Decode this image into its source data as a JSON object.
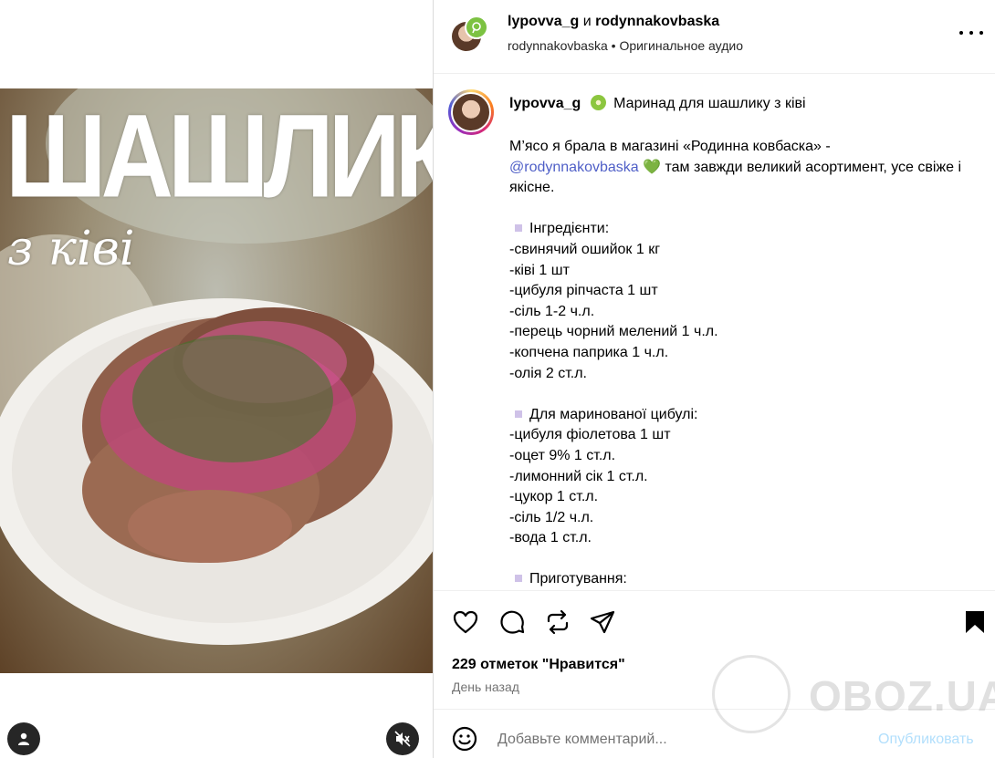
{
  "media": {
    "overlay_title": "ШАШЛИК",
    "overlay_subtitle": "з ківі",
    "user_tag_icon": "user-icon",
    "mute_icon": "speaker-muted-icon"
  },
  "header": {
    "user1": "lypovva_g",
    "conjunction": "и",
    "user2": "rodynnakovbaska",
    "sub_user": "rodynnakovbaska",
    "separator": "•",
    "audio": "Оригинальное аудио",
    "more_icon": "more-dots-icon"
  },
  "caption": {
    "username": "lypovva_g",
    "title": "Маринад для шашлику з ківі",
    "intro": "М’ясо я брала в магазині «Родинна ковбаска» -",
    "mention": "@rodynnakovbaska",
    "intro_rest": "там завжди великий асортимент, усе свіже і якісне.",
    "ingredients_heading": "Інгредієнти:",
    "ingredients": [
      "-свинячий ошийок 1 кг",
      "-ківі 1 шт",
      "-цибуля ріпчаста 1 шт",
      "-сіль 1-2 ч.л.",
      "-перець чорний мелений 1 ч.л.",
      "-копчена паприка 1 ч.л.",
      "-олія 2 ст.л."
    ],
    "onion_heading": "Для маринованої цибулі:",
    "onion_items": [
      "-цибуля фіолетова 1 шт",
      "-оцет 9% 1 ст.л.",
      "-лимонний сік 1 ст.л.",
      "-цукор 1 ст.л.",
      "-сіль 1/2 ч.л.",
      "-вода 1 ст.л."
    ],
    "prep_heading": "Приготування:"
  },
  "actions": {
    "like_icon": "heart-icon",
    "comment_icon": "comment-bubble-icon",
    "repost_icon": "repost-icon",
    "share_icon": "paper-plane-icon",
    "save_icon": "bookmark-icon",
    "likes_text": "229 отметок \"Нравится\"",
    "time_text": "День назад"
  },
  "comment": {
    "emoji_icon": "smiley-icon",
    "placeholder": "Добавьте комментарий...",
    "post_label": "Опубликовать"
  },
  "watermark": {
    "text": "OBOZ.UA"
  },
  "colors": {
    "link": "#4f5fc7",
    "post_disabled": "#b2dffc",
    "muted": "#737373",
    "badge_green": "#7cc242"
  }
}
